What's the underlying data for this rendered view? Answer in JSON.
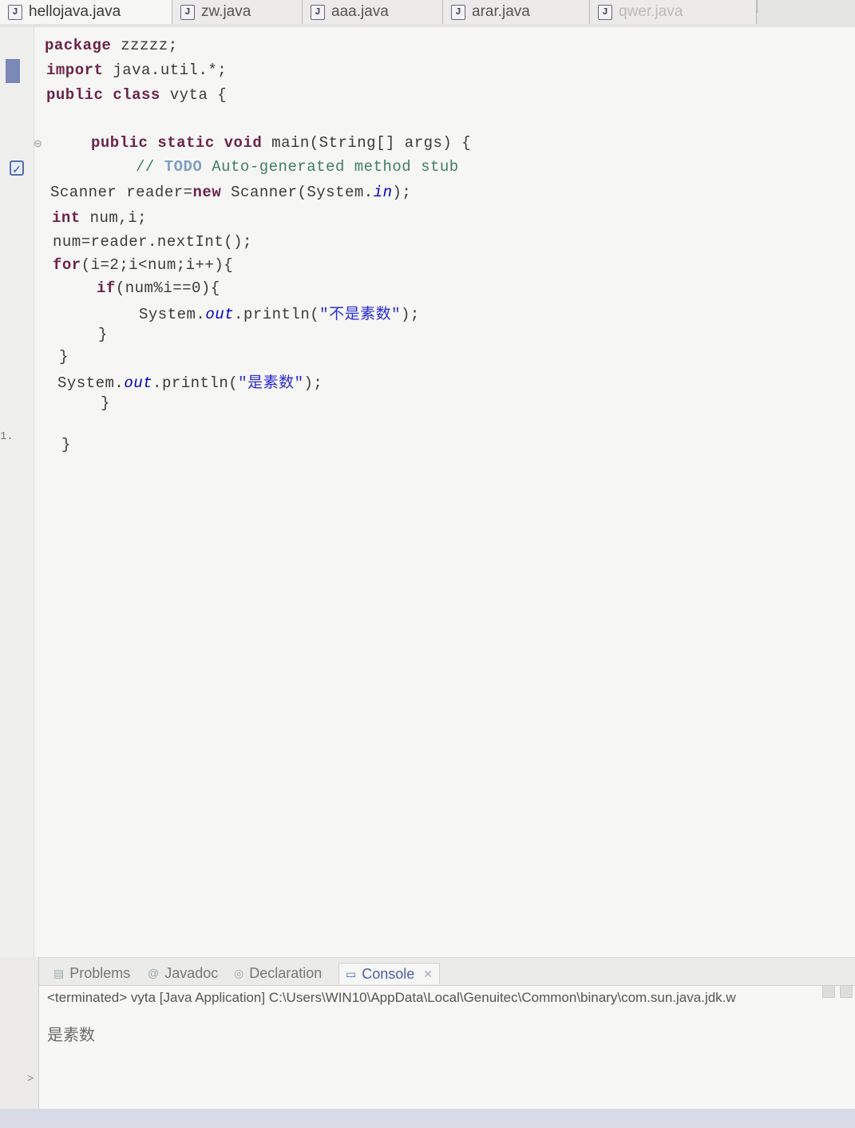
{
  "tabs": [
    {
      "label": "hellojava.java",
      "active": true
    },
    {
      "label": "zw.java",
      "active": false
    },
    {
      "label": "aaa.java",
      "active": false
    },
    {
      "label": "arar.java",
      "active": false
    },
    {
      "label": "qwer.java",
      "active": false
    }
  ],
  "editor": {
    "line_number_marker": "1."
  },
  "code": {
    "l1_kw": "package",
    "l1_rest": " zzzzz;",
    "l2_kw": "import",
    "l2_rest": " java.util.*;",
    "l3_kw1": "public",
    "l3_kw2": "class",
    "l3_rest": " vyta {",
    "l5_kw1": "public",
    "l5_kw2": "static",
    "l5_kw3": "void",
    "l5_rest": " main(String[] args) {",
    "l6_cmt": "// ",
    "l6_todo": "TODO",
    "l6_rest": " Auto-generated method stub",
    "l7_a": "Scanner reader=",
    "l7_kw": "new",
    "l7_b": " Scanner(System.",
    "l7_fld": "in",
    "l7_c": ");",
    "l8_kw": "int",
    "l8_rest": " num,i;",
    "l9": "num=reader.nextInt();",
    "l10_kw": "for",
    "l10_rest": "(i=2;i<num;i++){",
    "l11_kw": "if",
    "l11_rest": "(num%i==0){",
    "l12_a": "System.",
    "l12_fld": "out",
    "l12_b": ".println(",
    "l12_str": "\"不是素数\"",
    "l12_c": ");",
    "l13": "}",
    "l14": "}",
    "l15_a": "System.",
    "l15_fld": "out",
    "l15_b": ".println(",
    "l15_str": "\"是素数\"",
    "l15_c": ");",
    "l16": "}",
    "l18": "}"
  },
  "panel": {
    "tabs": [
      {
        "label": "Problems",
        "icon": "problems-icon"
      },
      {
        "label": "Javadoc",
        "icon": "at-icon"
      },
      {
        "label": "Declaration",
        "icon": "declaration-icon"
      },
      {
        "label": "Console",
        "icon": "console-icon",
        "active": true
      }
    ],
    "console_header": "<terminated> vyta [Java Application] C:\\Users\\WIN10\\AppData\\Local\\Genuitec\\Common\\binary\\com.sun.java.jdk.w",
    "console_output": "是素数"
  },
  "colors": {
    "keyword": "#6b2447",
    "string": "#2a2ad6",
    "field": "#0000c0",
    "comment": "#3f7f5f"
  }
}
